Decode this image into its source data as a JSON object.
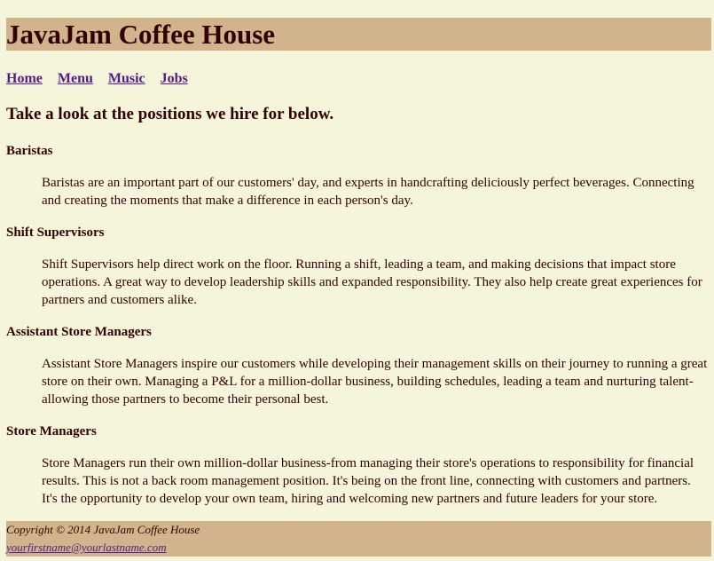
{
  "header": {
    "title": "JavaJam Coffee House"
  },
  "nav": {
    "items": [
      {
        "label": "Home"
      },
      {
        "label": "Menu"
      },
      {
        "label": "Music"
      },
      {
        "label": "Jobs"
      }
    ]
  },
  "main": {
    "intro": "Take a look at the positions we hire for below.",
    "positions": [
      {
        "title": "Baristas",
        "description": "Baristas are an important part of our customers' day, and experts in handcrafting deliciously perfect beverages. Connecting and creating the moments that make a difference in each person's day."
      },
      {
        "title": "Shift Supervisors",
        "description": "Shift Supervisors help direct work on the floor. Running a shift, leading a team, and making decisions that impact store operations. A great way to develop leadership skills and expanded responsibility. They also help create great experiences for partners and customers alike."
      },
      {
        "title": "Assistant Store Managers",
        "description": "Assistant Store Managers inspire our customers while developing their management skills on their journey to running a great store on their own. Managing a P&L for a million-dollar business, building schedules, leading a team and nurturing talent-allowing those partners to become their personal best."
      },
      {
        "title": "Store Managers",
        "description": "Store Managers run their own million-dollar business-from managing their store's operations to responsibility for financial results. This is not a back room management position. It's being on the front line, connecting with customers and partners. It's the opportunity to develop your own team, hiring and welcoming new partners and future leaders for your store."
      }
    ]
  },
  "footer": {
    "copyright": "Copyright © 2014 JavaJam Coffee House",
    "email": "yourfirstname@yourlastname.com"
  },
  "colors": {
    "page_background": "#f5f5dc",
    "header_background": "#d2b48c",
    "text": "#330000",
    "link": "#551a8b"
  }
}
